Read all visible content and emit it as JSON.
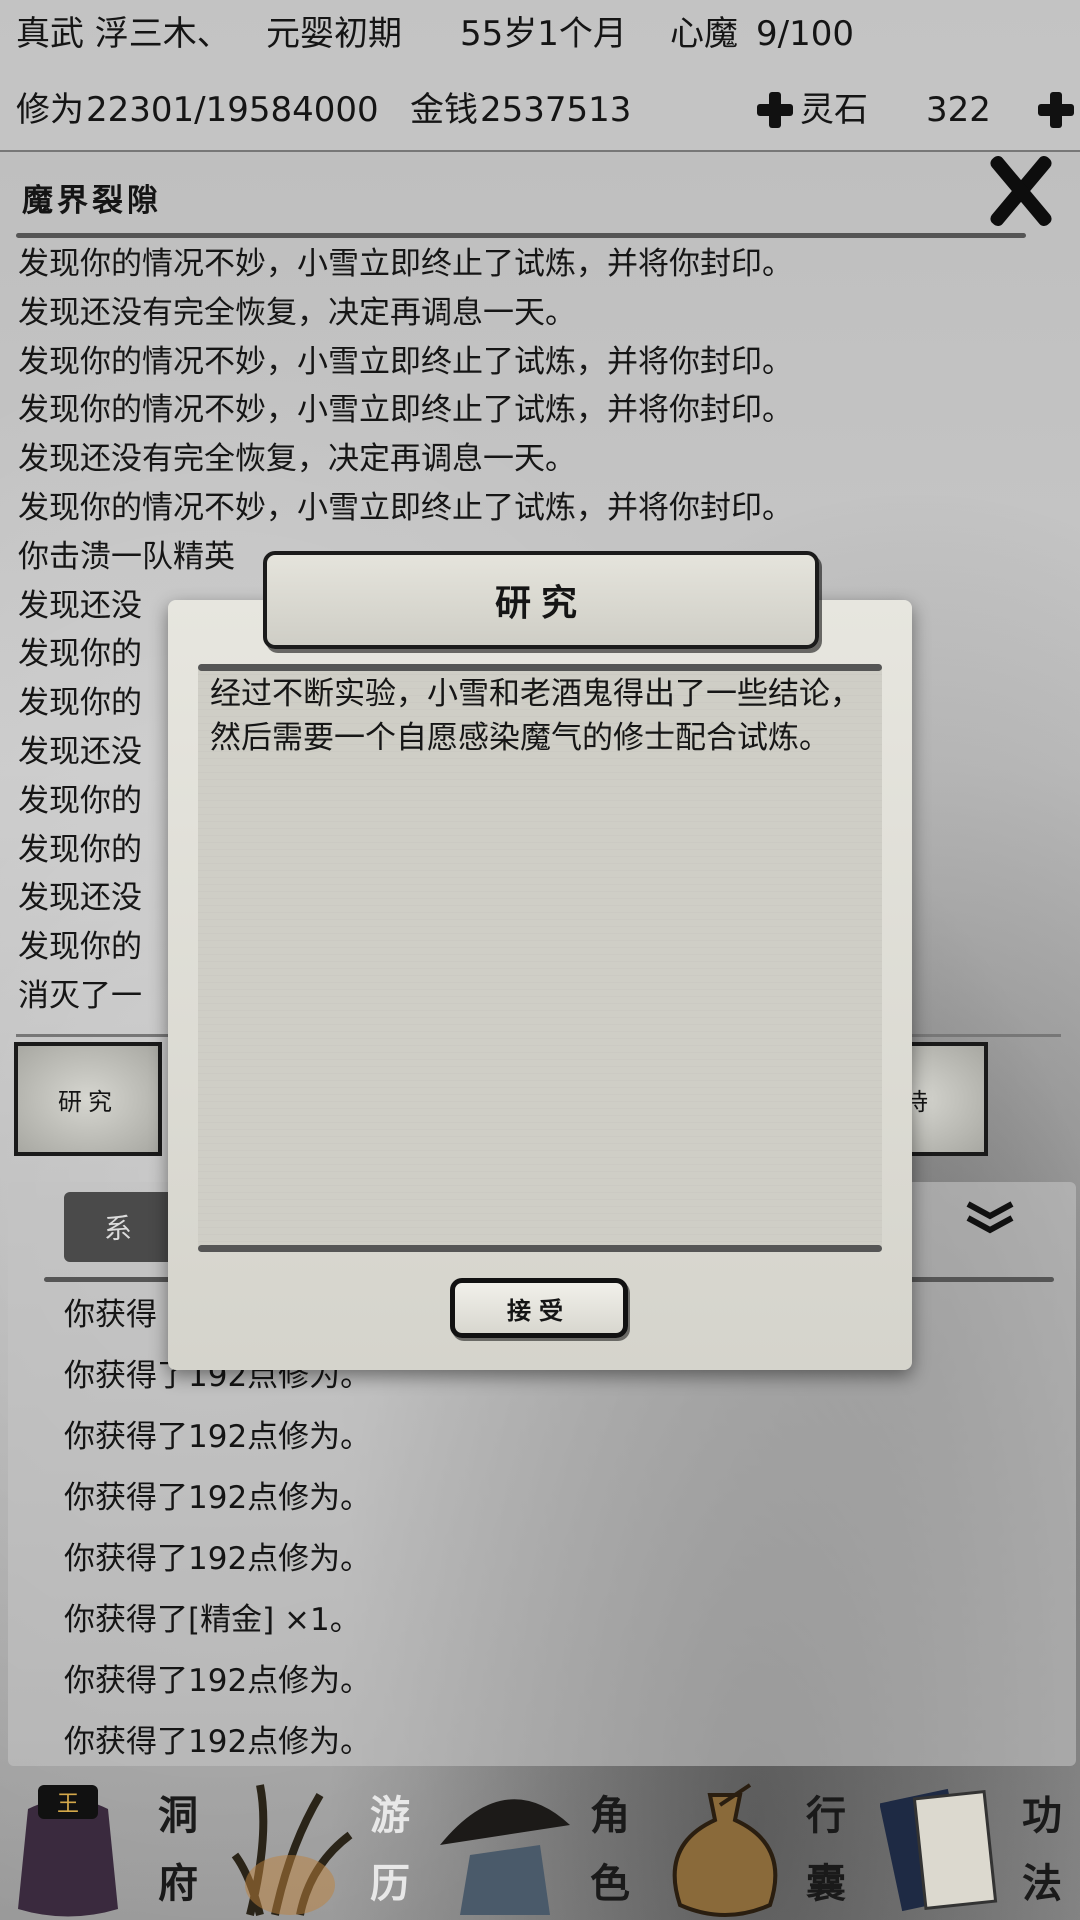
{
  "status": {
    "name": "真武 浮三木、",
    "realm": "元婴初期",
    "age": "55岁1个月",
    "heart_demon_label": "心魔",
    "heart_demon_value": "9/100",
    "cultivation_label": "修为",
    "cultivation_value": "22301/19584000",
    "money_label": "金钱",
    "money_value": "2537513",
    "spirit_stone_label": "灵石",
    "spirit_stone_value": "322"
  },
  "event": {
    "title": "魔界裂隙",
    "log": [
      "发现你的情况不妙，小雪立即终止了试炼，并将你封印。",
      "发现还没有完全恢复，决定再调息一天。",
      "发现你的情况不妙，小雪立即终止了试炼，并将你封印。",
      "发现你的情况不妙，小雪立即终止了试炼，并将你封印。",
      "发现还没有完全恢复，决定再调息一天。",
      "发现你的情况不妙，小雪立即终止了试炼，并将你封印。",
      "你击溃一队精英",
      "发现还没",
      "发现你的",
      "发现你的",
      "发现还没",
      "发现你的",
      "发现你的",
      "发现还没",
      "发现你的",
      "消灭了一"
    ],
    "options": [
      {
        "label": "研究"
      },
      {
        "label": "待"
      }
    ]
  },
  "messages": {
    "tab_label": "系",
    "lines": [
      "你获得",
      "你获得了192点修为。",
      "你获得了192点修为。",
      "你获得了192点修为。",
      "你获得了192点修为。",
      "你获得了[精金] ×1。",
      "你获得了192点修为。",
      "你获得了192点修为。"
    ]
  },
  "nav": [
    {
      "top": "洞",
      "bottom": "府",
      "icon": "cave-bag-icon"
    },
    {
      "top": "游",
      "bottom": "历",
      "icon": "grass-icon"
    },
    {
      "top": "角",
      "bottom": "色",
      "icon": "straw-hat-icon"
    },
    {
      "top": "行",
      "bottom": "囊",
      "icon": "pouch-icon"
    },
    {
      "top": "功",
      "bottom": "法",
      "icon": "scroll-book-icon"
    }
  ],
  "dialog": {
    "title": "研究",
    "body": "经过不断实验，小雪和老酒鬼得出了一些结论，然后需要一个自愿感染魔气的修士配合试炼。",
    "accept_label": "接受"
  }
}
